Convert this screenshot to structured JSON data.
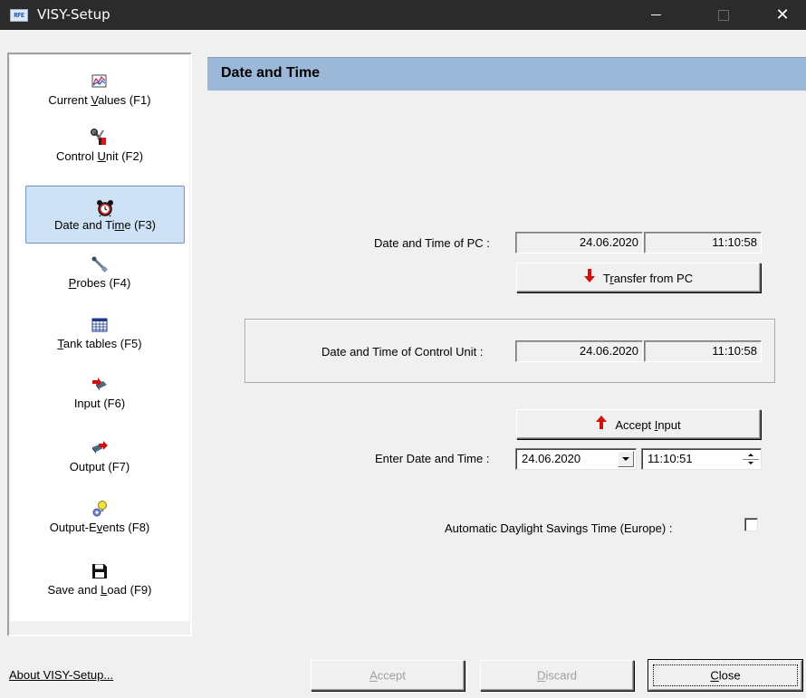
{
  "window": {
    "title": "VISY-Setup",
    "app_icon_text": "RFE",
    "close_glyph": "✕"
  },
  "sidebar": {
    "active_item": "date-time",
    "items": [
      {
        "id": "current-values",
        "pre": "Current ",
        "u": "V",
        "post": "alues (F1)",
        "icon": "chart-icon"
      },
      {
        "id": "control-unit",
        "pre": "Control ",
        "u": "U",
        "post": "nit (F2)",
        "icon": "tools-icon"
      },
      {
        "id": "date-time",
        "pre": "Date and Ti",
        "u": "m",
        "post": "e (F3)",
        "icon": "alarm-clock-icon"
      },
      {
        "id": "probes",
        "pre": "",
        "u": "P",
        "post": "robes (F4)",
        "icon": "probe-icon"
      },
      {
        "id": "tank-tables",
        "pre": "",
        "u": "T",
        "post": "ank tables (F5)",
        "icon": "table-icon"
      },
      {
        "id": "input",
        "pre": "Input (F6)",
        "u": "",
        "post": "",
        "icon": "input-icon"
      },
      {
        "id": "output",
        "pre": "Output (F7)",
        "u": "",
        "post": "",
        "icon": "output-icon"
      },
      {
        "id": "output-events",
        "pre": "Output-E",
        "u": "v",
        "post": "ents (F8)",
        "icon": "gear-bulb-icon"
      },
      {
        "id": "save-load",
        "pre": "Save and ",
        "u": "L",
        "post": "oad (F9)",
        "icon": "floppy-disk-icon"
      }
    ]
  },
  "page": {
    "title": "Date and Time"
  },
  "pc_time": {
    "label": "Date and Time of PC :",
    "date": "24.06.2020",
    "time": "11:10:58",
    "transfer_pre": "T",
    "transfer_u": "r",
    "transfer_post": "ansfer from PC"
  },
  "control_unit_time": {
    "label": "Date and Time of Control Unit :",
    "date": "24.06.2020",
    "time": "11:10:58"
  },
  "enter_time": {
    "accept_pre": "Accept ",
    "accept_u": "I",
    "accept_post": "nput",
    "label": "Enter Date and Time :",
    "date_value": "24.06.2020",
    "time_value": "11:10:51"
  },
  "dst": {
    "label": "Automatic Daylight Savings Time (Europe) :",
    "checked": false
  },
  "footer": {
    "about_label": "About VISY-Setup...",
    "accept_u": "A",
    "accept_post": "ccept",
    "discard_u": "D",
    "discard_post": "iscard",
    "close_u": "C",
    "close_post": "lose"
  },
  "colors": {
    "header_bg": "#9bb8d8",
    "active_nav_bg": "#cfe1f5",
    "arrow_red": "#d01010",
    "titlebar_bg": "#2b2b2b"
  }
}
